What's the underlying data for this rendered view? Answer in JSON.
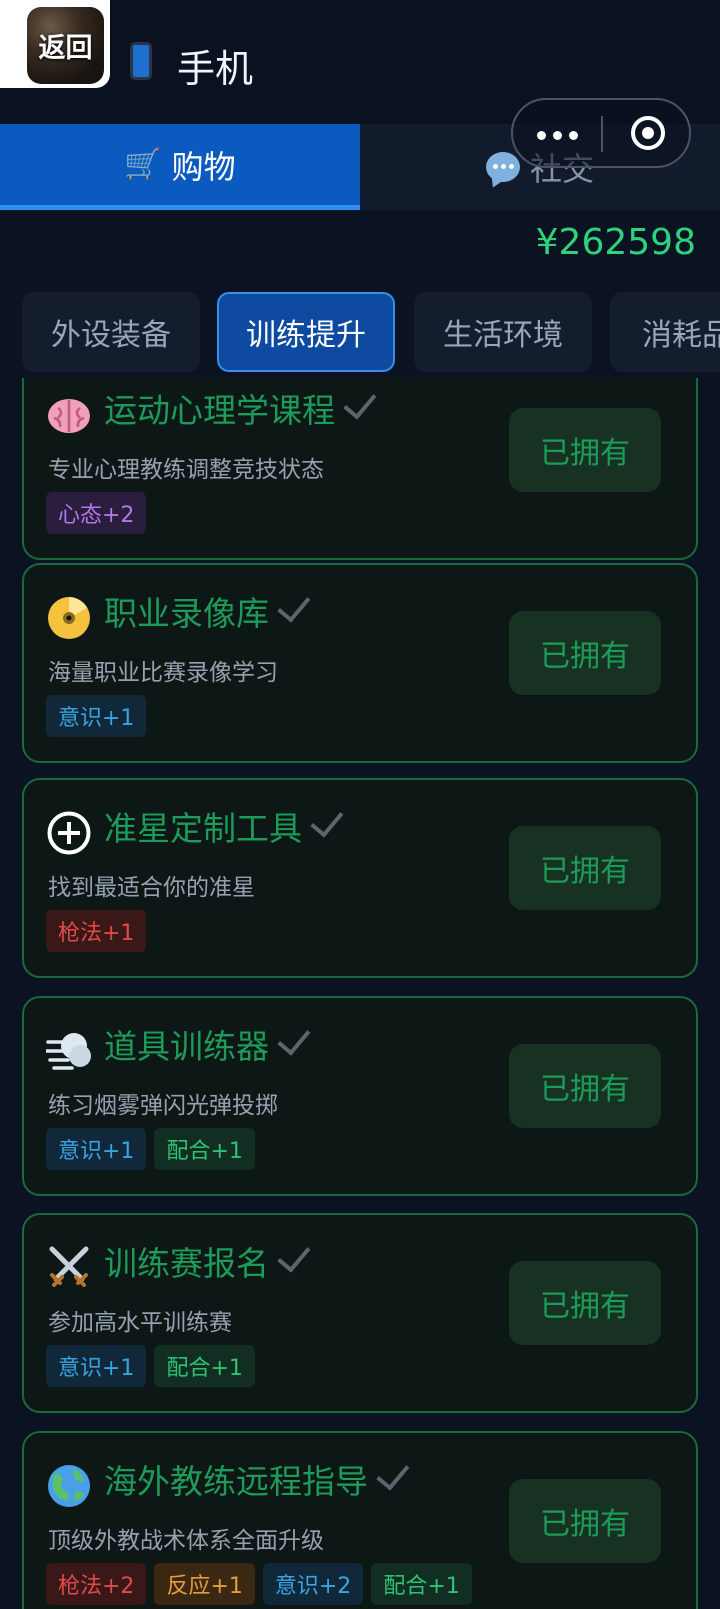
{
  "header": {
    "back_label": "返回",
    "title": "手机",
    "phone_icon": "mobile-phone-icon"
  },
  "main_tabs": [
    {
      "label": "购物",
      "icon": "shopping-cart-icon",
      "active": true
    },
    {
      "label": "社交",
      "icon": "speech-bubble-icon",
      "active": false
    }
  ],
  "balance": "¥262598",
  "categories": [
    {
      "label": "外设装备",
      "active": false
    },
    {
      "label": "训练提升",
      "active": true
    },
    {
      "label": "生活环境",
      "active": false
    },
    {
      "label": "消耗品",
      "active": false
    }
  ],
  "items": [
    {
      "icon": "brain-icon",
      "title": "运动心理学课程",
      "desc": "专业心理教练调整竞技状态",
      "tags": [
        {
          "text": "心态+2",
          "color": "#b377e8"
        }
      ],
      "button": "已拥有"
    },
    {
      "icon": "dvd-icon",
      "title": "职业录像库",
      "desc": "海量职业比赛录像学习",
      "tags": [
        {
          "text": "意识+1",
          "color": "#3aa3e0"
        }
      ],
      "button": "已拥有"
    },
    {
      "icon": "crosshair-plus-icon",
      "title": "准星定制工具",
      "desc": "找到最适合你的准星",
      "tags": [
        {
          "text": "枪法+1",
          "color": "#e14a4a"
        }
      ],
      "button": "已拥有"
    },
    {
      "icon": "wind-icon",
      "title": "道具训练器",
      "desc": "练习烟雾弹闪光弹投掷",
      "tags": [
        {
          "text": "意识+1",
          "color": "#3aa3e0"
        },
        {
          "text": "配合+1",
          "color": "#2ec274"
        }
      ],
      "button": "已拥有"
    },
    {
      "icon": "crossed-swords-icon",
      "title": "训练赛报名",
      "desc": "参加高水平训练赛",
      "tags": [
        {
          "text": "意识+1",
          "color": "#3aa3e0"
        },
        {
          "text": "配合+1",
          "color": "#2ec274"
        }
      ],
      "button": "已拥有"
    },
    {
      "icon": "globe-icon",
      "title": "海外教练远程指导",
      "desc": "顶级外教战术体系全面升级",
      "tags": [
        {
          "text": "枪法+2",
          "color": "#e14a4a"
        },
        {
          "text": "反应+1",
          "color": "#e69a3a"
        },
        {
          "text": "意识+2",
          "color": "#3aa3e0"
        },
        {
          "text": "配合+1",
          "color": "#2ec274"
        }
      ],
      "button": "已拥有"
    }
  ],
  "colors": {
    "accent_blue": "#0a5ac0",
    "money_green": "#2fd27c",
    "owned_green": "#1d9b58",
    "background": "#0b1323"
  }
}
